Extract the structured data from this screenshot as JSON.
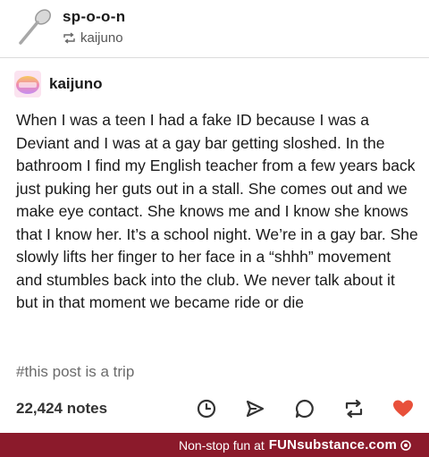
{
  "header": {
    "username": "sp-o-o-n",
    "reblogged_from": "kaijuno"
  },
  "post": {
    "author": "kaijuno",
    "body": "When I was a teen I had a fake ID because I was a Deviant and I was at a gay bar getting sloshed. In the bathroom I find my English teacher from a few years back just puking her guts out in a stall. She comes out and we make eye contact. She knows me and I know she knows that I know her. It’s a school night. We’re in a gay bar. She slowly lifts her finger to her face in a “shhh” movement and stumbles back into the club. We never talk about it but in that moment we became ride or die",
    "tag": "#this post is a trip",
    "notes": "22,424 notes"
  },
  "actions": {
    "icons": [
      "clock-icon",
      "share-icon",
      "reply-icon",
      "reblog-icon",
      "heart-icon"
    ],
    "heart_color": "#e8503a"
  },
  "footer": {
    "tagline": "Non-stop fun at",
    "brand": "FUNsubstance.com",
    "background": "#8b1a2b"
  }
}
